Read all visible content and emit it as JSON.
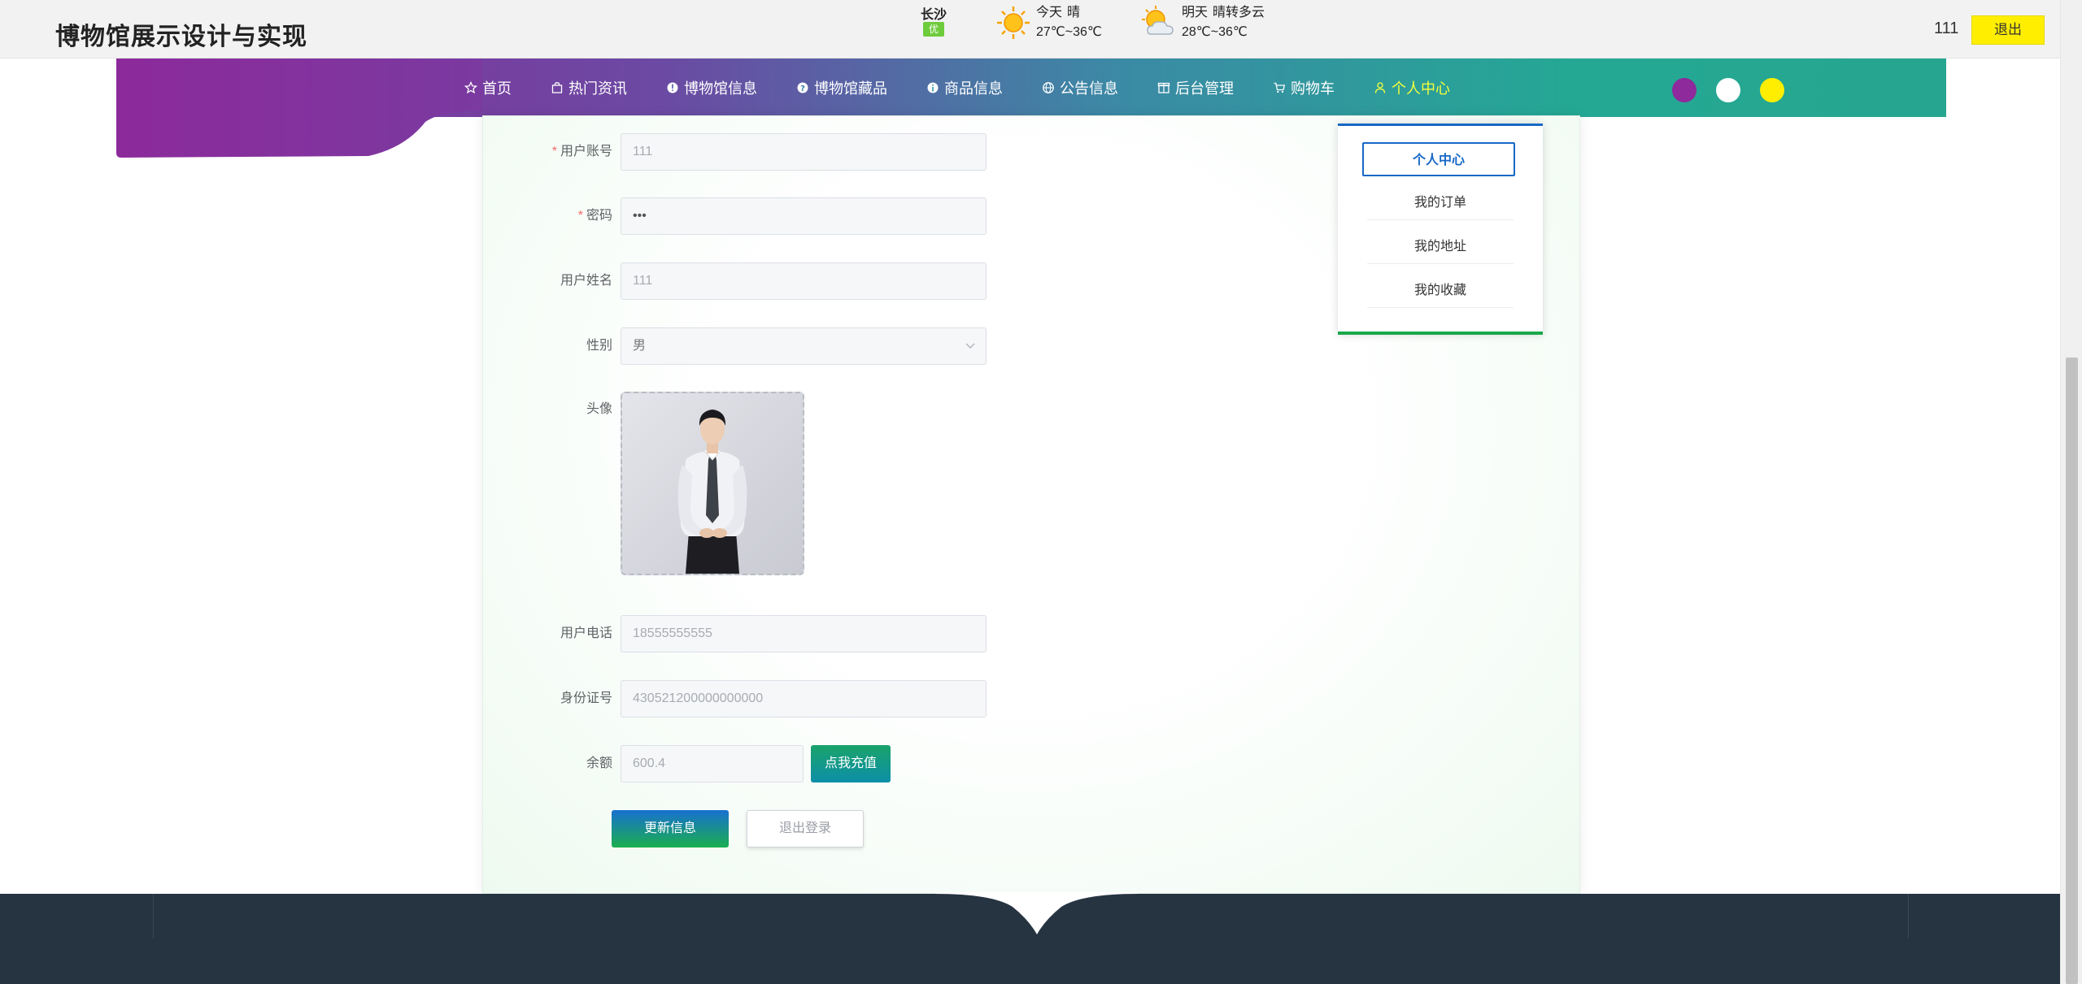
{
  "header": {
    "title": "博物馆展示设计与实现",
    "city": "长沙",
    "city_badge": "优",
    "today": {
      "label": "今天",
      "condition": "晴",
      "temp": "27℃~36℃"
    },
    "tomorrow": {
      "label": "明天",
      "condition": "晴转多云",
      "temp": "28℃~36℃"
    },
    "username": "111",
    "logout": "退出"
  },
  "nav": {
    "items": [
      {
        "label": "首页",
        "icon": "star-icon"
      },
      {
        "label": "热门资讯",
        "icon": "bag-icon"
      },
      {
        "label": "博物馆信息",
        "icon": "info-icon"
      },
      {
        "label": "博物馆藏品",
        "icon": "question-icon"
      },
      {
        "label": "商品信息",
        "icon": "info-icon"
      },
      {
        "label": "公告信息",
        "icon": "globe-icon"
      },
      {
        "label": "后台管理",
        "icon": "box-icon"
      },
      {
        "label": "购物车",
        "icon": "cart-icon"
      },
      {
        "label": "个人中心",
        "icon": "user-icon"
      }
    ],
    "theme_colors": [
      "#8e2a9c",
      "#ffffff",
      "#ffee00"
    ]
  },
  "form": {
    "account_label": "用户账号",
    "account_value": "111",
    "password_label": "密码",
    "password_value": "•••",
    "name_label": "用户姓名",
    "name_value": "111",
    "gender_label": "性别",
    "gender_value": "男",
    "avatar_label": "头像",
    "phone_label": "用户电话",
    "phone_value": "18555555555",
    "idcard_label": "身份证号",
    "idcard_value": "430521200000000000",
    "balance_label": "余额",
    "balance_value": "600.4",
    "recharge_button": "点我充值",
    "update_button": "更新信息",
    "logout_button": "退出登录"
  },
  "side_menu": {
    "items": [
      "个人中心",
      "我的订单",
      "我的地址",
      "我的收藏"
    ]
  }
}
